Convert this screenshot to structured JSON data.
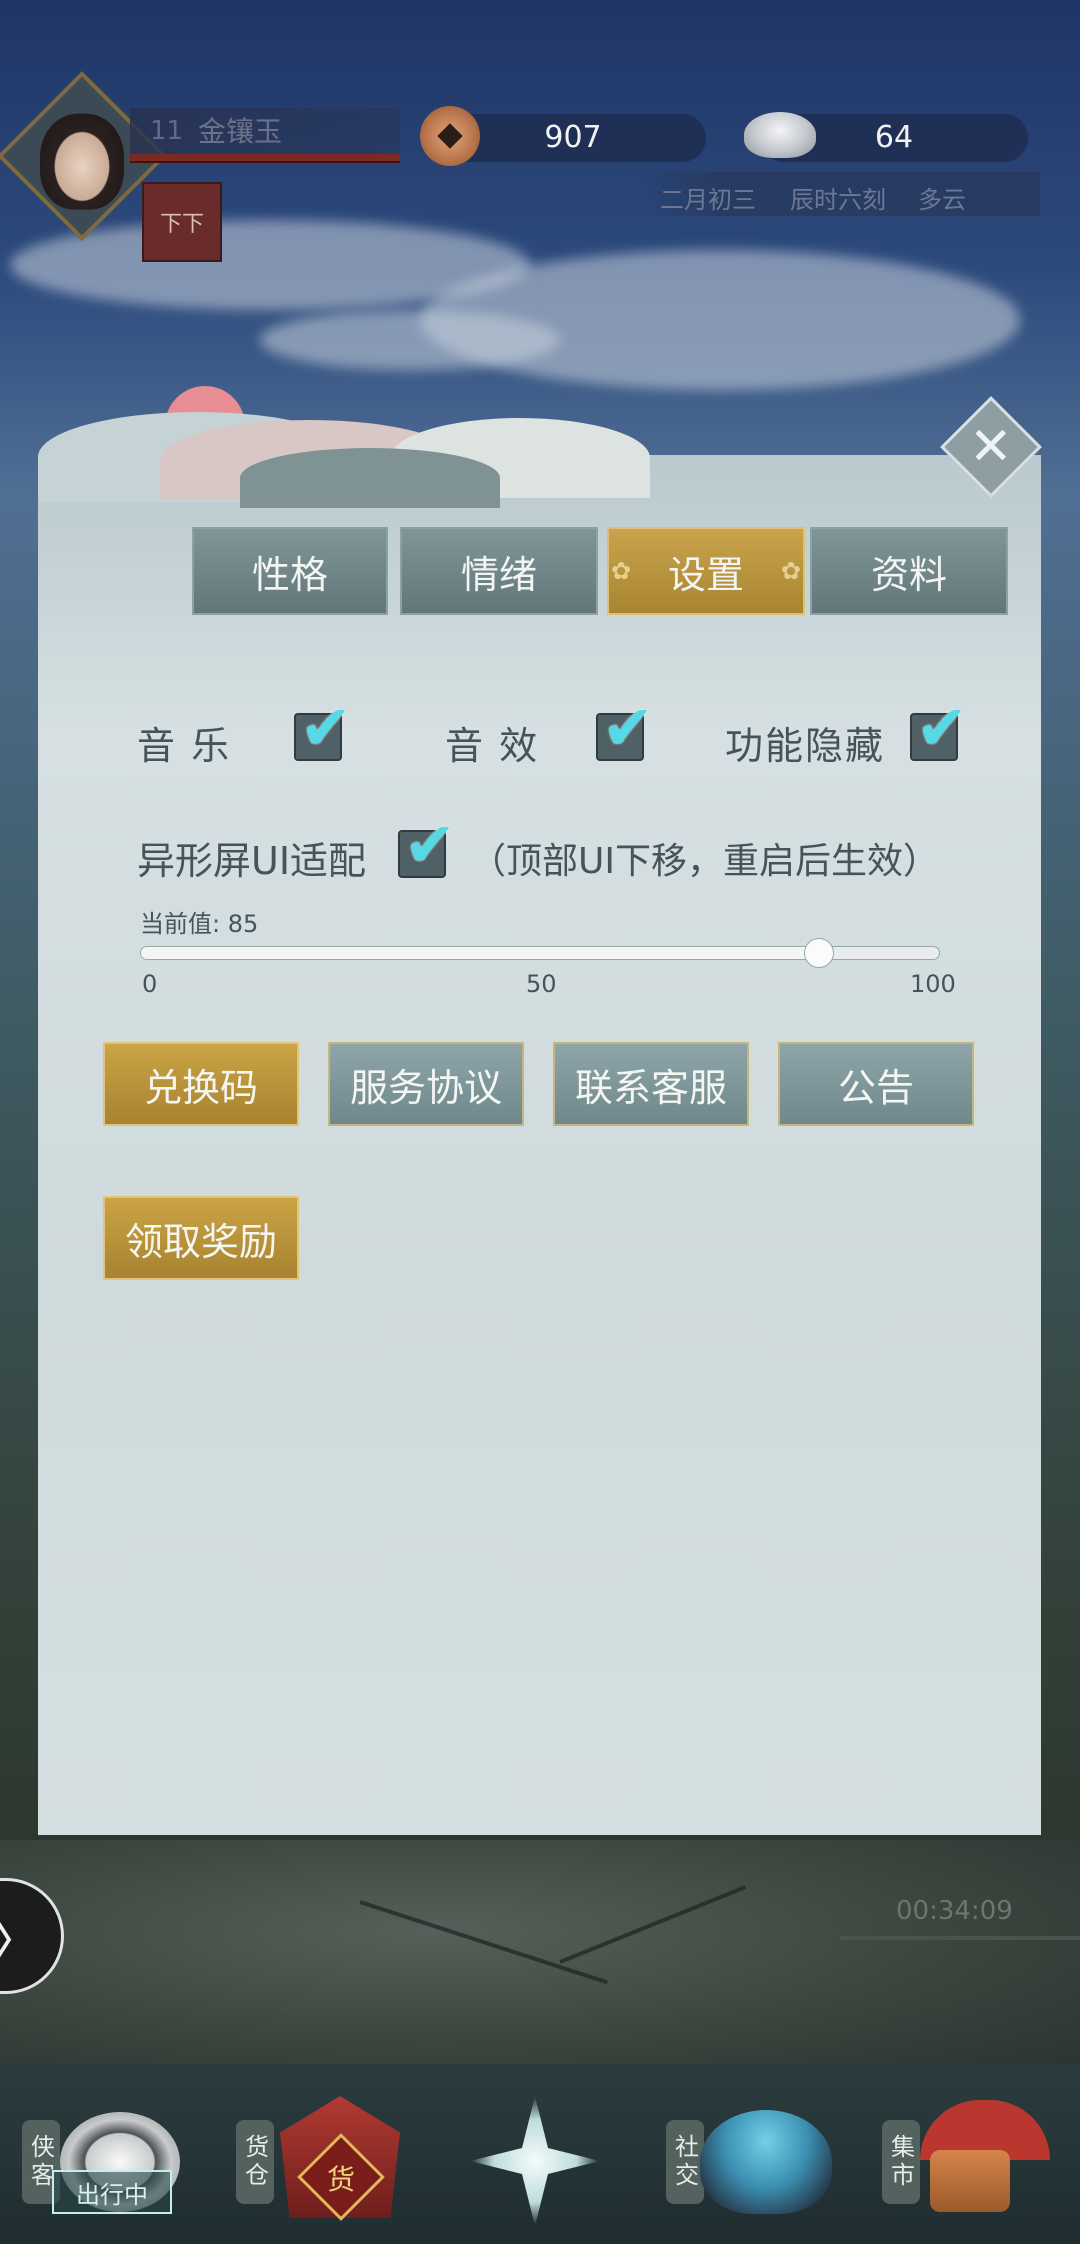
{
  "player": {
    "level": "11",
    "name": "金镶玉",
    "buff_glyph": "下下"
  },
  "currency": {
    "copper": "907",
    "silver": "64"
  },
  "time": {
    "date": "二月初三",
    "hour": "辰时六刻",
    "weather": "多云"
  },
  "panel": {
    "close_glyph": "✕",
    "tabs": [
      {
        "label": "性格",
        "active": false
      },
      {
        "label": "情绪",
        "active": false
      },
      {
        "label": "设置",
        "active": true
      },
      {
        "label": "资料",
        "active": false
      }
    ],
    "options": {
      "music": {
        "label": "音 乐",
        "checked": true
      },
      "sfx": {
        "label": "音 效",
        "checked": true
      },
      "hide_func": {
        "label": "功能隐藏",
        "checked": true
      },
      "notch": {
        "label": "异形屏UI适配",
        "checked": true,
        "hint": "（顶部UI下移，重启后生效）"
      }
    },
    "check_glyph": "✔",
    "slider": {
      "current_label": "当前值: 85",
      "value": 85,
      "min": 0,
      "max": 100,
      "ticks": [
        "0",
        "50",
        "100"
      ]
    },
    "buttons": [
      {
        "label": "兑换码",
        "style": "gold"
      },
      {
        "label": "服务协议",
        "style": "teal"
      },
      {
        "label": "联系客服",
        "style": "teal"
      },
      {
        "label": "公告",
        "style": "teal"
      },
      {
        "label": "领取奖励",
        "style": "gold"
      }
    ]
  },
  "side_toggle_glyph": "〉",
  "timer": "00:34:09",
  "bottom_nav": {
    "items": [
      {
        "label": "侠客",
        "icon": "chakram-icon"
      },
      {
        "label": "货仓",
        "icon": "shop-gate-icon",
        "sign": "货"
      },
      {
        "label": "",
        "icon": "star-compass-icon"
      },
      {
        "label": "社交",
        "icon": "wave-shell-icon"
      },
      {
        "label": "集市",
        "icon": "market-stall-icon"
      }
    ],
    "outing_label": "出行中"
  },
  "colors": {
    "gold": "#c9a44c",
    "teal": "#7f9597",
    "check": "#56d9e6",
    "panel": "#d4dfe1"
  }
}
